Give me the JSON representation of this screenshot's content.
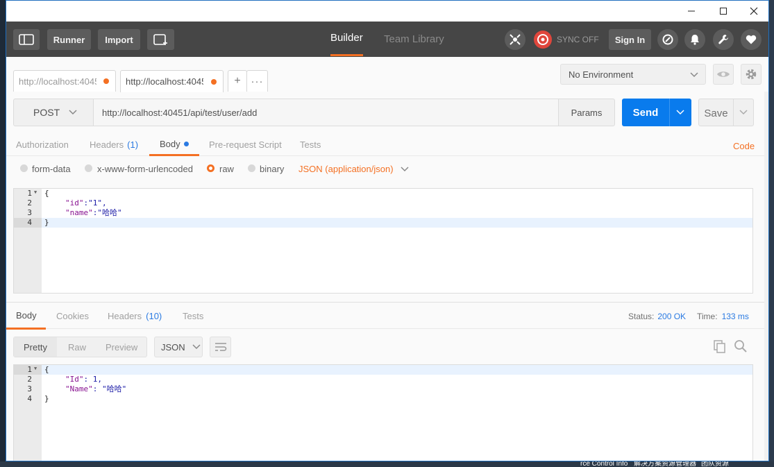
{
  "toolbar": {
    "runner_label": "Runner",
    "import_label": "Import",
    "builder_tab": "Builder",
    "team_library_tab": "Team Library",
    "sync_label": "SYNC OFF",
    "signin_label": "Sign In"
  },
  "tabs": [
    {
      "label": "http://localhost:4045",
      "unsaved": true
    },
    {
      "label": "http://localhost:4045",
      "unsaved": true
    }
  ],
  "environment": {
    "selected": "No Environment"
  },
  "request": {
    "method": "POST",
    "url": "http://localhost:40451/api/test/user/add",
    "params_label": "Params",
    "send_label": "Send",
    "save_label": "Save"
  },
  "request_tabs": {
    "authorization": "Authorization",
    "headers": "Headers",
    "headers_count": "(1)",
    "body": "Body",
    "prerequest": "Pre-request Script",
    "tests": "Tests",
    "code_link": "Code"
  },
  "body_options": {
    "form_data": "form-data",
    "urlencoded": "x-www-form-urlencoded",
    "raw": "raw",
    "binary": "binary",
    "content_type": "JSON (application/json)"
  },
  "request_body": {
    "line_numbers": [
      "1",
      "2",
      "3",
      "4"
    ],
    "line1": "{",
    "l2_key": "\"id\"",
    "l2_rest": ":\"1\",",
    "l3_key": "\"name\"",
    "l3_rest": ":\"哈哈\"",
    "line4": "}"
  },
  "response_tabs": {
    "body": "Body",
    "cookies": "Cookies",
    "headers": "Headers",
    "headers_count": "(10)",
    "tests": "Tests",
    "status_label": "Status:",
    "status_value": "200 OK",
    "time_label": "Time:",
    "time_value": "133 ms"
  },
  "response_view": {
    "pretty": "Pretty",
    "raw": "Raw",
    "preview": "Preview",
    "format": "JSON"
  },
  "response_body": {
    "line_numbers": [
      "1",
      "2",
      "3",
      "4"
    ],
    "line1": "{",
    "l2_key": "\"Id\"",
    "l2_rest": ": 1,",
    "l3_key": "\"Name\"",
    "l3_rest": ": \"哈哈\"",
    "line4": "}"
  },
  "background": {
    "taskbar_text": "rce Control Info",
    "taskbar_text2": "解决方案资源管理器",
    "taskbar_text3": "团队资源"
  },
  "colors": {
    "accent": "#f47023",
    "send": "#097bed",
    "toolbar": "#464646",
    "link": "#2a7ae2"
  },
  "icons": [
    "sidebar-toggle-icon",
    "new-window-icon",
    "interceptor-icon",
    "sync-icon",
    "satellite-icon",
    "bell-icon",
    "wrench-icon",
    "heart-icon",
    "eye-icon",
    "gear-icon",
    "copy-icon",
    "search-icon",
    "wrap-icon"
  ]
}
